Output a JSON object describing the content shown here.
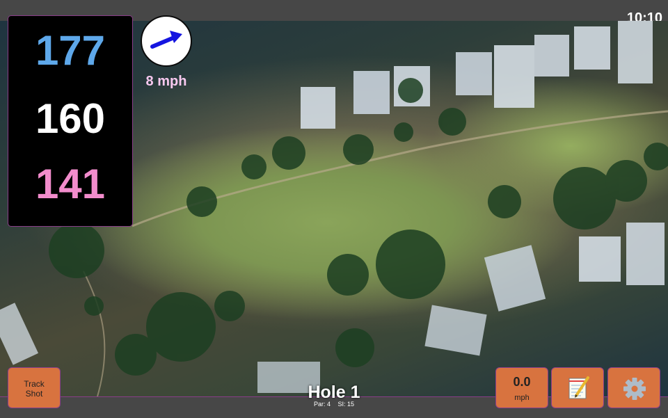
{
  "status": {
    "time": "10:10"
  },
  "distances": {
    "back": "177",
    "center": "160",
    "front": "141"
  },
  "wind": {
    "speed": "8 mph",
    "icon": "arrow-up-right-icon"
  },
  "track_button": {
    "line1": "Track",
    "line2": "Shot"
  },
  "speed_button": {
    "value": "0.0",
    "unit": "mph"
  },
  "notes_button": {
    "icon": "notepad-icon"
  },
  "settings_button": {
    "icon": "gear-icon"
  },
  "hole": {
    "title": "Hole 1",
    "par": "Par: 4",
    "si": "SI: 15"
  },
  "colors": {
    "back": "#5ea8ea",
    "center": "#ffffff",
    "front": "#f28ccc",
    "button": "#d8733f",
    "border": "#8a3d8a"
  }
}
